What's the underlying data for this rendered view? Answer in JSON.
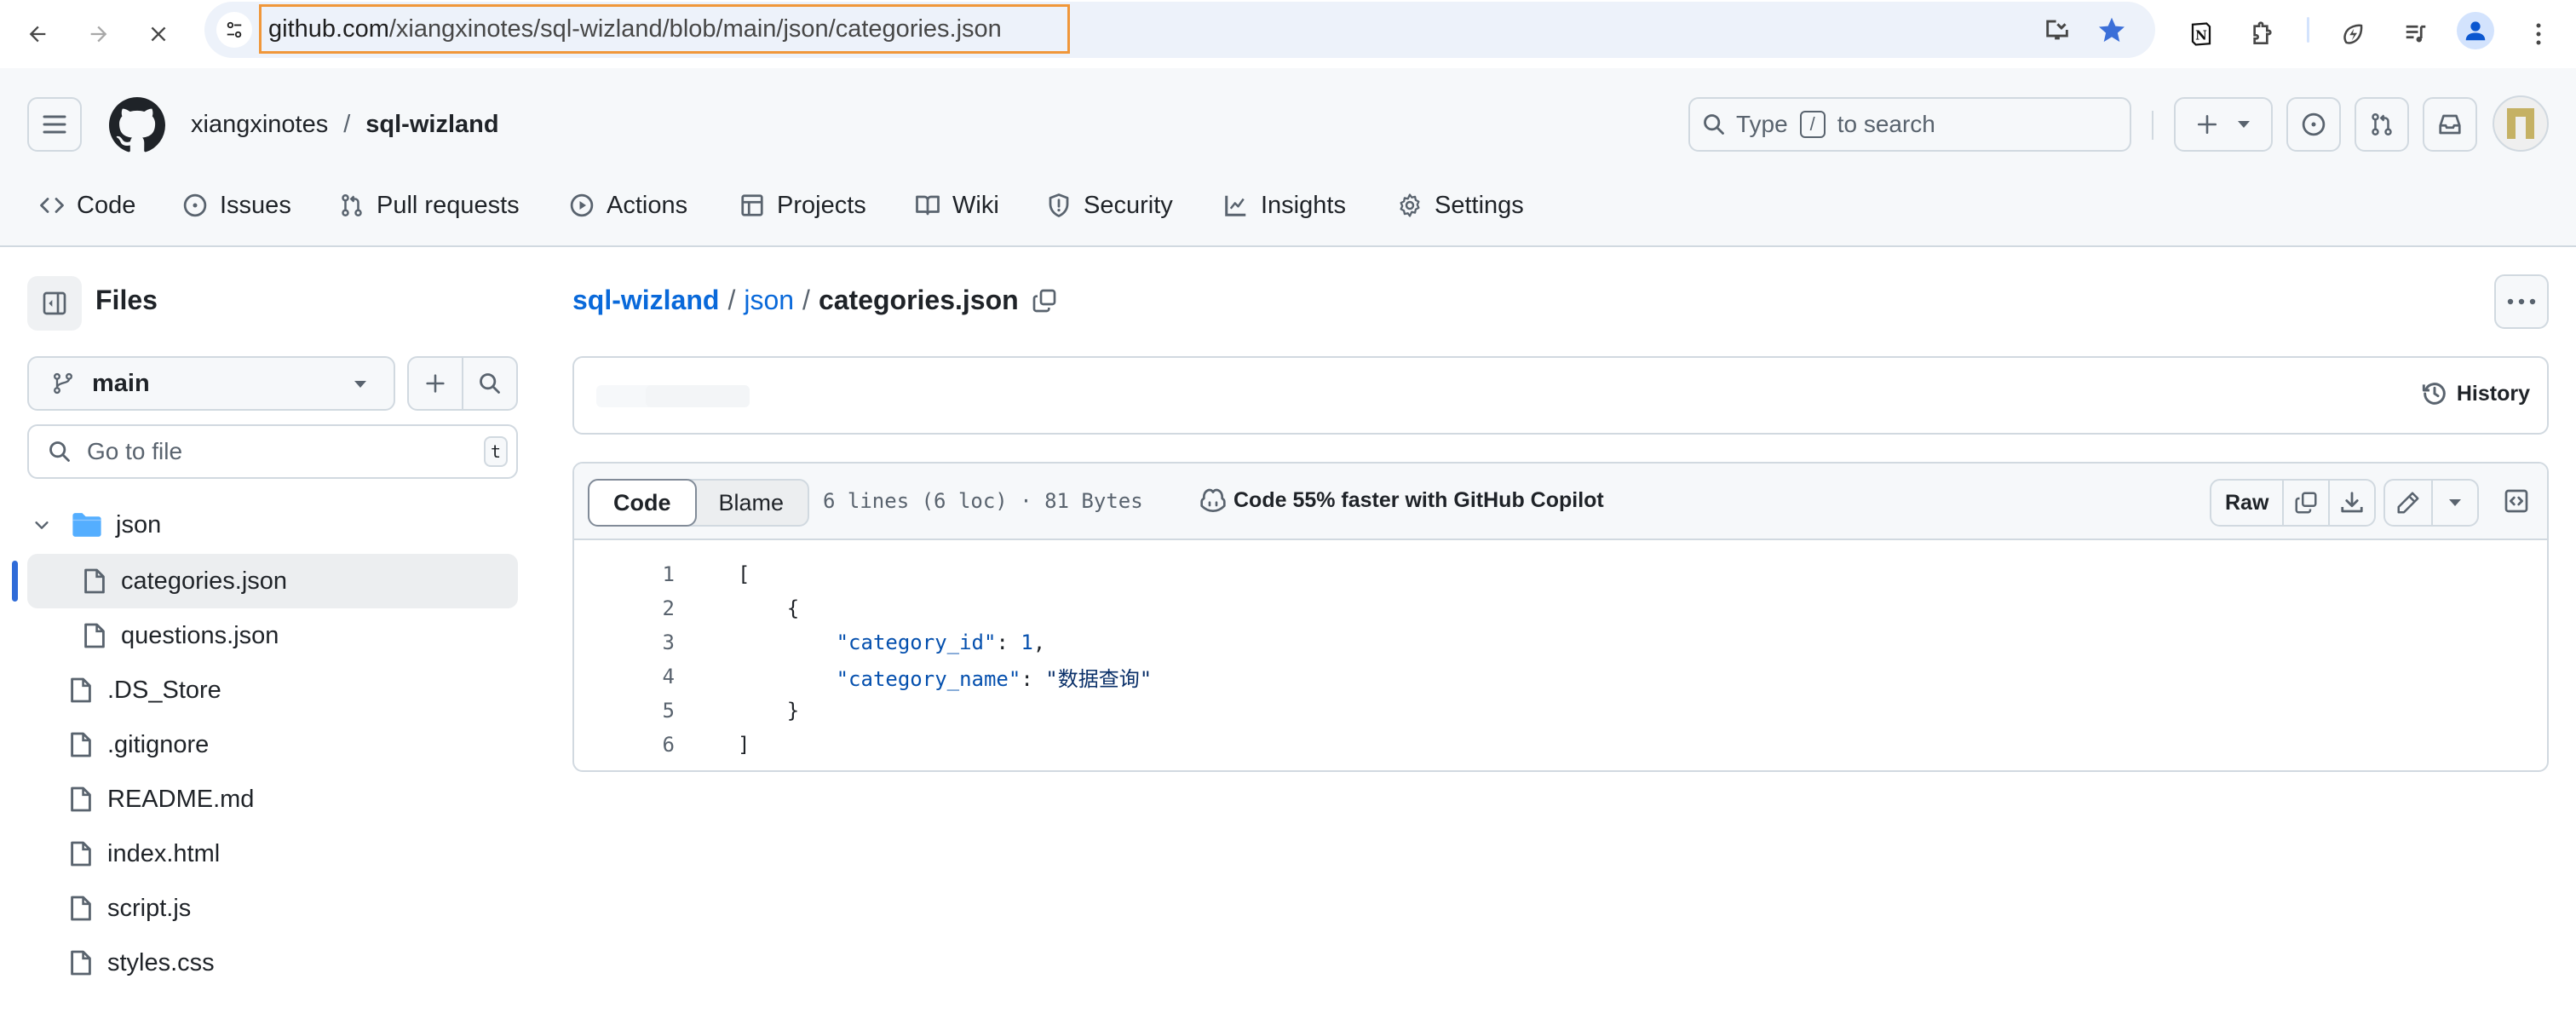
{
  "browser": {
    "url_host": "github.com",
    "url_path": "/xiangxinotes/sql-wizland/blob/main/json/categories.json",
    "back_icon": "arrow-left-icon",
    "forward_icon": "arrow-right-icon",
    "stop_icon": "close-icon",
    "site_info_icon": "tune-icon",
    "install_icon": "install-app-icon",
    "bookmark_icon": "star-filled-icon",
    "extensions": [
      "notion-icon",
      "puzzle-extensions-icon",
      "leaf-bolt-icon",
      "media-queue-icon"
    ],
    "profile_icon": "profile-icon",
    "menu_icon": "kebab-menu-icon",
    "colors": {
      "url_highlight": "#f0973a",
      "star": "#3b6fd8",
      "omnibox_bg": "#edf2fa"
    }
  },
  "header": {
    "owner": "xiangxinotes",
    "separator": "/",
    "repo": "sql-wizland",
    "search_prefix": "Type",
    "search_key": "/",
    "search_suffix": "to search",
    "avatar_color": "#c5b164"
  },
  "repo_nav": {
    "tabs": [
      {
        "label": "Code",
        "icon": "code-icon"
      },
      {
        "label": "Issues",
        "icon": "issue-opened-icon"
      },
      {
        "label": "Pull requests",
        "icon": "git-pull-request-icon"
      },
      {
        "label": "Actions",
        "icon": "play-icon"
      },
      {
        "label": "Projects",
        "icon": "table-icon"
      },
      {
        "label": "Wiki",
        "icon": "book-icon"
      },
      {
        "label": "Security",
        "icon": "shield-icon"
      },
      {
        "label": "Insights",
        "icon": "graph-icon"
      },
      {
        "label": "Settings",
        "icon": "gear-icon"
      }
    ]
  },
  "sidebar": {
    "title": "Files",
    "branch": "main",
    "goto_placeholder": "Go to file",
    "goto_shortcut": "t",
    "tree": [
      {
        "name": "json",
        "type": "folder",
        "expanded": true,
        "depth": 0
      },
      {
        "name": "categories.json",
        "type": "file",
        "depth": 1,
        "selected": true
      },
      {
        "name": "questions.json",
        "type": "file",
        "depth": 1
      },
      {
        "name": ".DS_Store",
        "type": "file",
        "depth": 0
      },
      {
        "name": ".gitignore",
        "type": "file",
        "depth": 0
      },
      {
        "name": "README.md",
        "type": "file",
        "depth": 0
      },
      {
        "name": "index.html",
        "type": "file",
        "depth": 0
      },
      {
        "name": "script.js",
        "type": "file",
        "depth": 0
      },
      {
        "name": "styles.css",
        "type": "file",
        "depth": 0
      }
    ]
  },
  "file": {
    "breadcrumb": {
      "repo": "sql-wizland",
      "dir": "json",
      "sep": "/",
      "current": "categories.json"
    },
    "history_label": "History",
    "view_tabs": {
      "code": "Code",
      "blame": "Blame"
    },
    "meta": "6 lines (6 loc) · 81 Bytes",
    "copilot_label": "Code 55% faster with GitHub Copilot",
    "raw_label": "Raw",
    "lines": [
      {
        "no": "1",
        "indent": "",
        "tokens": [
          [
            "tok-punc",
            "["
          ]
        ]
      },
      {
        "no": "2",
        "indent": "    ",
        "tokens": [
          [
            "tok-punc",
            "{"
          ]
        ]
      },
      {
        "no": "3",
        "indent": "        ",
        "tokens": [
          [
            "tok-prop",
            "\"category_id\""
          ],
          [
            "tok-punc",
            ": "
          ],
          [
            "tok-num",
            "1"
          ],
          [
            "tok-punc",
            ","
          ]
        ]
      },
      {
        "no": "4",
        "indent": "        ",
        "tokens": [
          [
            "tok-prop",
            "\"category_name\""
          ],
          [
            "tok-punc",
            ": "
          ],
          [
            "tok-str",
            "\"数据查询\""
          ]
        ]
      },
      {
        "no": "5",
        "indent": "    ",
        "tokens": [
          [
            "tok-punc",
            "}"
          ]
        ]
      },
      {
        "no": "6",
        "indent": "",
        "tokens": [
          [
            "tok-punc",
            "]"
          ]
        ]
      }
    ]
  }
}
